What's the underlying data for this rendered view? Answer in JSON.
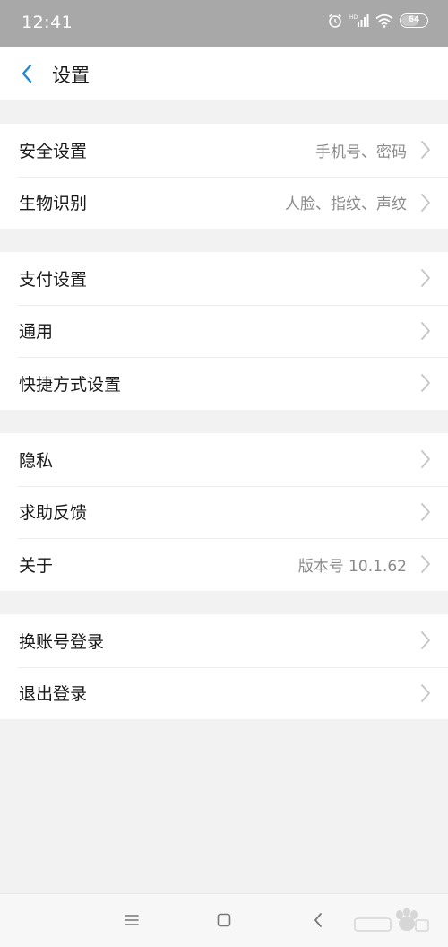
{
  "status_bar": {
    "time": "12:41",
    "battery": "64",
    "icons": [
      "alarm-icon",
      "hd-signal-icon",
      "wifi-icon",
      "battery-icon"
    ]
  },
  "header": {
    "title": "设置",
    "back_icon": "chevron-left-icon"
  },
  "groups": [
    {
      "items": [
        {
          "label": "安全设置",
          "value": "手机号、密码"
        },
        {
          "label": "生物识别",
          "value": "人脸、指纹、声纹"
        }
      ]
    },
    {
      "items": [
        {
          "label": "支付设置",
          "value": ""
        },
        {
          "label": "通用",
          "value": ""
        },
        {
          "label": "快捷方式设置",
          "value": ""
        }
      ]
    },
    {
      "items": [
        {
          "label": "隐私",
          "value": ""
        },
        {
          "label": "求助反馈",
          "value": ""
        },
        {
          "label": "关于",
          "value": "版本号 10.1.62"
        }
      ]
    },
    {
      "items": [
        {
          "label": "换账号登录",
          "value": ""
        },
        {
          "label": "退出登录",
          "value": ""
        }
      ]
    }
  ],
  "nav_bar": {
    "icons": [
      "menu-icon",
      "home-icon",
      "back-icon"
    ]
  },
  "colors": {
    "accent": "#1e88d2",
    "status_bar": "#a8a8a8",
    "background": "#f2f2f2"
  }
}
